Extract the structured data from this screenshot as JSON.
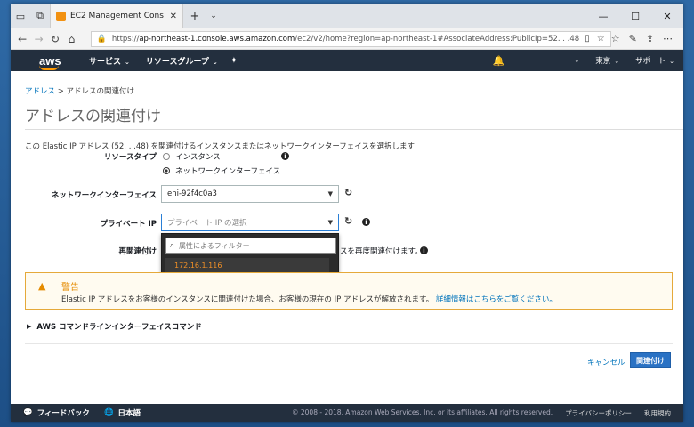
{
  "browser": {
    "tab_title": "EC2 Management Cons",
    "url_prefix": "https://",
    "url_host": "ap-northeast-1.console.aws.amazon.com",
    "url_path": "/ec2/v2/home?region=ap-northeast-1#AssociateAddress:PublicIp=52.    .    .48"
  },
  "awsnav": {
    "logo": "aws",
    "services": "サービス",
    "resource_groups": "リソースグループ",
    "region": "東京",
    "support": "サポート"
  },
  "breadcrumb": {
    "link": "アドレス",
    "separator": " > ",
    "current": "アドレスの関連付け"
  },
  "page": {
    "title": "アドレスの関連付け",
    "description": "この Elastic IP アドレス (52.      .      .48) を関連付けるインスタンスまたはネットワークインターフェイスを選択します"
  },
  "form": {
    "resource_type_label": "リソースタイプ",
    "option_instance": "インスタンス",
    "option_eni": "ネットワークインターフェイス",
    "eni_label": "ネットワークインターフェイス",
    "eni_value": "eni-92f4c0a3",
    "private_ip_label": "プライベート IP",
    "private_ip_placeholder": "プライベート IP の選択",
    "reassoc_label": "再関連付け",
    "reassoc_text": "スを再度関連付けます。"
  },
  "dropdown": {
    "filter_placeholder": "属性によるフィルター",
    "items": [
      "172.16.1.116"
    ]
  },
  "warning": {
    "title": "警告",
    "text": "Elastic IP アドレスをお客様のインスタンスに関連付けた場合、お客様の現在の IP アドレスが解放されます。",
    "link": "詳細情報はこちらをご覧ください。"
  },
  "cli": {
    "label": "AWS コマンドラインインターフェイスコマンド"
  },
  "actions": {
    "cancel": "キャンセル",
    "submit": "関連付け"
  },
  "footer": {
    "feedback": "フィードバック",
    "language": "日本語",
    "copyright": "© 2008 - 2018, Amazon Web Services, Inc. or its affiliates. All rights reserved.",
    "privacy": "プライバシーポリシー",
    "terms": "利用規約"
  },
  "colors": {
    "aws_nav": "#232f3e",
    "accent_orange": "#ff9900",
    "link_blue": "#0073bb",
    "primary_button": "#2a72c4",
    "warning": "#e58b00"
  }
}
